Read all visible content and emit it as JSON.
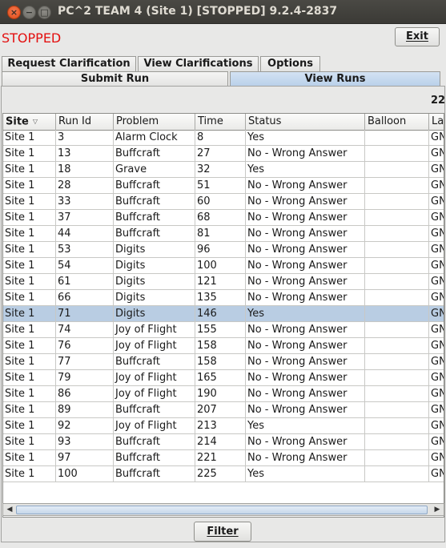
{
  "window": {
    "title": "PC^2 TEAM 4 (Site 1) [STOPPED] 9.2.4-2837",
    "close_glyph": "×",
    "minimize_glyph": "−",
    "maximize_glyph": "□"
  },
  "status": {
    "text": "STOPPED",
    "color": "#e31010"
  },
  "exit_button": {
    "label": "Exit",
    "mnemonic": "E"
  },
  "tabs_row1": [
    {
      "label": "Request Clarification"
    },
    {
      "label": "View Clarifications"
    },
    {
      "label": "Options"
    }
  ],
  "tabs_row2": [
    {
      "label": "Submit Run"
    },
    {
      "label": "View Runs",
      "selected": true
    }
  ],
  "runs_count": "22",
  "table": {
    "columns": [
      "Site",
      "Run Id",
      "Problem",
      "Time",
      "Status",
      "Balloon",
      "La"
    ],
    "sort_column": "Site",
    "sort_indicator_icon": "sort-descending-icon",
    "selected_row_index": 11,
    "rows": [
      [
        "Site 1",
        "3",
        "Alarm Clock",
        "8",
        "Yes",
        "",
        "GN"
      ],
      [
        "Site 1",
        "13",
        "Buffcraft",
        "27",
        "No - Wrong Answer",
        "",
        "GN"
      ],
      [
        "Site 1",
        "18",
        "Grave",
        "32",
        "Yes",
        "",
        "GN"
      ],
      [
        "Site 1",
        "28",
        "Buffcraft",
        "51",
        "No - Wrong Answer",
        "",
        "GN"
      ],
      [
        "Site 1",
        "33",
        "Buffcraft",
        "60",
        "No - Wrong Answer",
        "",
        "GN"
      ],
      [
        "Site 1",
        "37",
        "Buffcraft",
        "68",
        "No - Wrong Answer",
        "",
        "GN"
      ],
      [
        "Site 1",
        "44",
        "Buffcraft",
        "81",
        "No - Wrong Answer",
        "",
        "GN"
      ],
      [
        "Site 1",
        "53",
        "Digits",
        "96",
        "No - Wrong Answer",
        "",
        "GN"
      ],
      [
        "Site 1",
        "54",
        "Digits",
        "100",
        "No - Wrong Answer",
        "",
        "GN"
      ],
      [
        "Site 1",
        "61",
        "Digits",
        "121",
        "No - Wrong Answer",
        "",
        "GN"
      ],
      [
        "Site 1",
        "66",
        "Digits",
        "135",
        "No - Wrong Answer",
        "",
        "GN"
      ],
      [
        "Site 1",
        "71",
        "Digits",
        "146",
        "Yes",
        "",
        "GN"
      ],
      [
        "Site 1",
        "74",
        "Joy of Flight",
        "155",
        "No - Wrong Answer",
        "",
        "GN"
      ],
      [
        "Site 1",
        "76",
        "Joy of Flight",
        "158",
        "No - Wrong Answer",
        "",
        "GN"
      ],
      [
        "Site 1",
        "77",
        "Buffcraft",
        "158",
        "No - Wrong Answer",
        "",
        "GN"
      ],
      [
        "Site 1",
        "79",
        "Joy of Flight",
        "165",
        "No - Wrong Answer",
        "",
        "GN"
      ],
      [
        "Site 1",
        "86",
        "Joy of Flight",
        "190",
        "No - Wrong Answer",
        "",
        "GN"
      ],
      [
        "Site 1",
        "89",
        "Buffcraft",
        "207",
        "No - Wrong Answer",
        "",
        "GN"
      ],
      [
        "Site 1",
        "92",
        "Joy of Flight",
        "213",
        "Yes",
        "",
        "GN"
      ],
      [
        "Site 1",
        "93",
        "Buffcraft",
        "214",
        "No - Wrong Answer",
        "",
        "GN"
      ],
      [
        "Site 1",
        "97",
        "Buffcraft",
        "221",
        "No - Wrong Answer",
        "",
        "GN"
      ],
      [
        "Site 1",
        "100",
        "Buffcraft",
        "225",
        "Yes",
        "",
        "GN"
      ]
    ]
  },
  "scrollbar": {
    "left_arrow": "◀",
    "right_arrow": "▶"
  },
  "filter_button": {
    "label": "Filter",
    "mnemonic": "F"
  }
}
